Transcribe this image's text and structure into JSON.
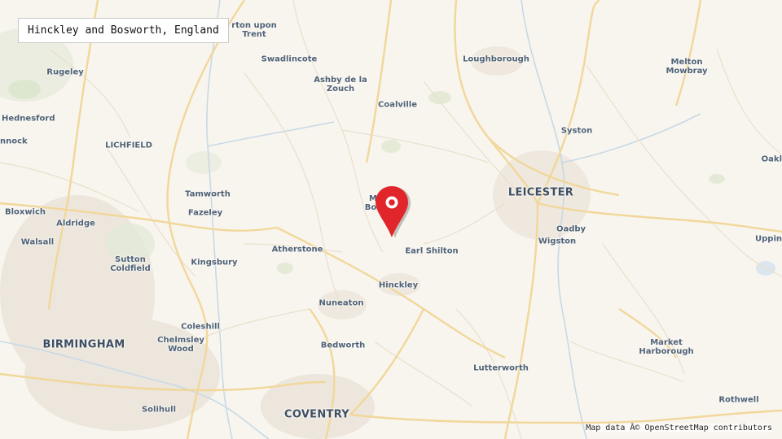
{
  "title": "Hinckley and Bosworth, England",
  "attribution": "Map data Â© OpenStreetMap contributors",
  "marker": {
    "icon": "map-pin-icon",
    "color": "#e0262b"
  },
  "places": [
    {
      "id": "burton-upon-trent",
      "label": "rton upon\nTrent"
    },
    {
      "id": "swadlincote",
      "label": "Swadlincote"
    },
    {
      "id": "loughborough",
      "label": "Loughborough"
    },
    {
      "id": "melton-mowbray",
      "label": "Melton\nMowbray"
    },
    {
      "id": "rugeley",
      "label": "Rugeley"
    },
    {
      "id": "ashby-de-la-zouch",
      "label": "Ashby de la\nZouch"
    },
    {
      "id": "coalville",
      "label": "Coalville"
    },
    {
      "id": "hednesford",
      "label": "Hednesford"
    },
    {
      "id": "syston",
      "label": "Syston"
    },
    {
      "id": "cannock",
      "label": "nnock"
    },
    {
      "id": "lichfield",
      "label": "LICHFIELD"
    },
    {
      "id": "oakham",
      "label": "Oakl"
    },
    {
      "id": "tamworth",
      "label": "Tamworth"
    },
    {
      "id": "leicester",
      "label": "LEICESTER"
    },
    {
      "id": "market-bosworth",
      "label": "M\nBos"
    },
    {
      "id": "bloxwich",
      "label": "Bloxwich"
    },
    {
      "id": "fazeley",
      "label": "Fazeley"
    },
    {
      "id": "aldridge",
      "label": "Aldridge"
    },
    {
      "id": "oadby",
      "label": "Oadby"
    },
    {
      "id": "walsall",
      "label": "Walsall"
    },
    {
      "id": "wigston",
      "label": "Wigston"
    },
    {
      "id": "uppingham",
      "label": "Uppin"
    },
    {
      "id": "atherstone",
      "label": "Atherstone"
    },
    {
      "id": "earl-shilton",
      "label": "Earl Shilton"
    },
    {
      "id": "sutton-coldfield",
      "label": "Sutton\nColdfield"
    },
    {
      "id": "kingsbury",
      "label": "Kingsbury"
    },
    {
      "id": "hinckley",
      "label": "Hinckley"
    },
    {
      "id": "nuneaton",
      "label": "Nuneaton"
    },
    {
      "id": "coleshill",
      "label": "Coleshill"
    },
    {
      "id": "market-harborough",
      "label": "Market\nHarborough"
    },
    {
      "id": "birmingham",
      "label": "BIRMINGHAM"
    },
    {
      "id": "chelmsley-wood",
      "label": "Chelmsley\nWood"
    },
    {
      "id": "bedworth",
      "label": "Bedworth"
    },
    {
      "id": "lutterworth",
      "label": "Lutterworth"
    },
    {
      "id": "rothwell",
      "label": "Rothwell"
    },
    {
      "id": "solihull",
      "label": "Solihull"
    },
    {
      "id": "coventry",
      "label": "COVENTRY"
    }
  ]
}
